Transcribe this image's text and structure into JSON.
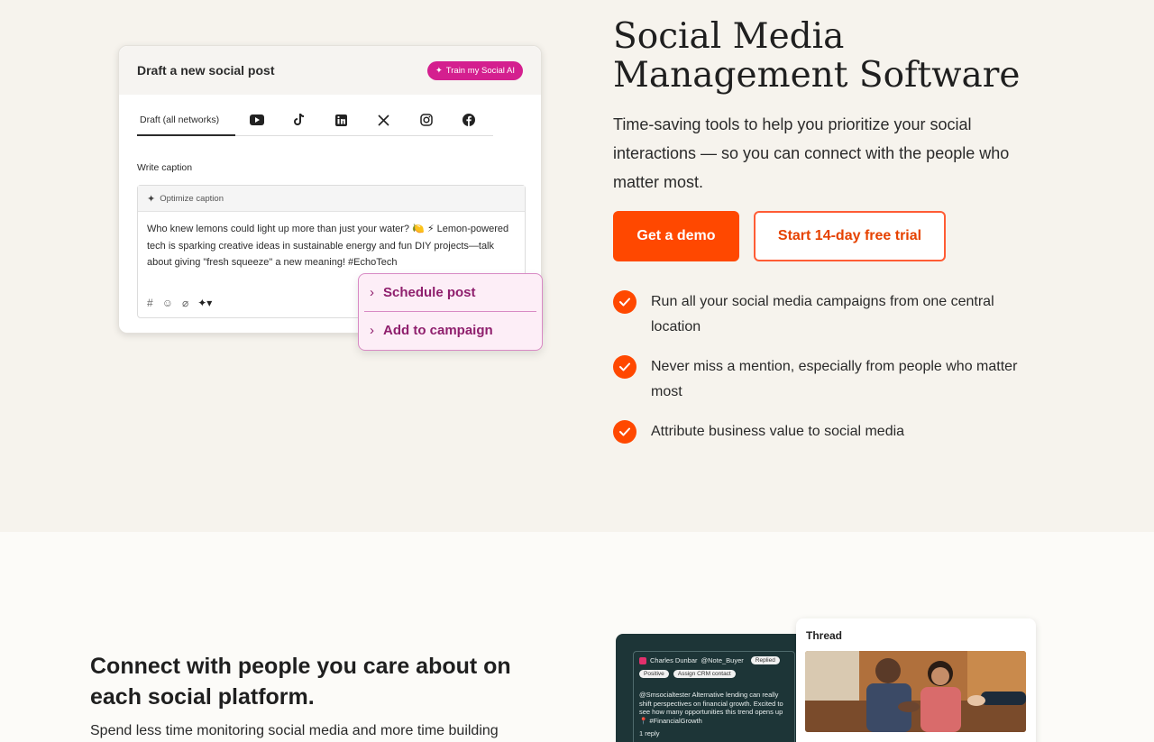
{
  "composer": {
    "title": "Draft a new social post",
    "ai_button": "Train my Social AI",
    "tab_draft": "Draft (all networks)",
    "networks": [
      "youtube-icon",
      "tiktok-icon",
      "linkedin-icon",
      "x-icon",
      "instagram-icon",
      "facebook-icon"
    ],
    "write_label": "Write caption",
    "optimize_label": "Optimize caption",
    "caption": "Who knew lemons could light up more than just your water? 🍋 ⚡ Lemon-powered tech is sparking creative ideas in sustainable energy and fun DIY projects—talk about giving \"fresh squeeze\" a new meaning! #EchoTech"
  },
  "popup": {
    "schedule": "Schedule post",
    "campaign": "Add to campaign"
  },
  "hero": {
    "title": "Social Media Management Software",
    "subtitle": "Time-saving tools to help you prioritize your social interactions — so you can connect with the people who matter most.",
    "demo_button": "Get a demo",
    "trial_button": "Start 14-day free trial",
    "bullets": [
      "Run all your social media campaigns from one central location",
      "Never miss a mention, especially from people who matter most",
      "Attribute business value to social media"
    ]
  },
  "section2": {
    "heading": "Connect with people you care about on each social platform.",
    "text": "Spend less time monitoring social media and more time building"
  },
  "inbox": {
    "author": "Charles Dunbar",
    "mention": "@Note_Buyer",
    "status": "Replied",
    "tag1": "Positive",
    "tag2": "Assign CRM contact",
    "message": "@Smsocialtester Alternative lending can really shift perspectives on financial growth. Excited to see how many opportunities this trend opens up 📍 #FinancialGrowth",
    "replies": "1 reply"
  },
  "thread": {
    "title": "Thread"
  },
  "colors": {
    "accent": "#ff4800",
    "magenta": "#d41f8f",
    "hero_bg": "#f6f3ed"
  }
}
